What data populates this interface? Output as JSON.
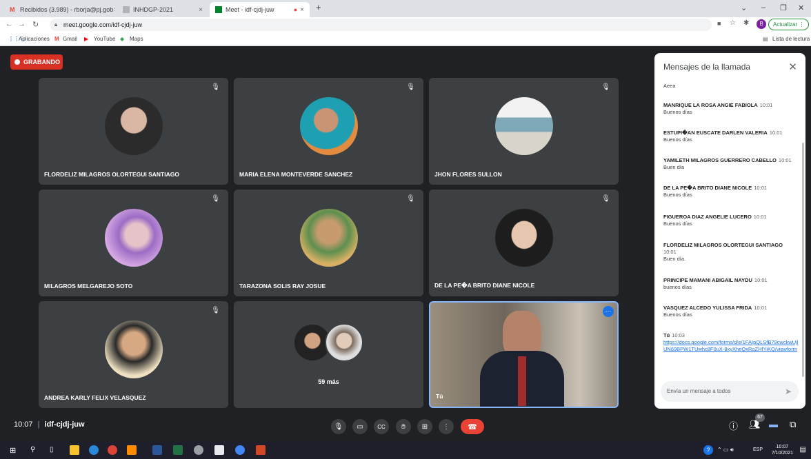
{
  "browser": {
    "tabs": [
      {
        "label": "Recibidos (3.989) - rborja@pj.gob",
        "close": "×"
      },
      {
        "label": "INHDGP-2021",
        "close": "×"
      },
      {
        "label": "Meet - idf-cjdj-juw",
        "close": "×"
      }
    ],
    "new_tab": "+",
    "url": "meet.google.com/idf-cjdj-juw",
    "update_label": "Actualizar",
    "profile_initial": "B",
    "bookmarks": [
      "Aplicaciones",
      "Gmail",
      "YouTube",
      "Maps"
    ],
    "reading_list": "Lista de lectura"
  },
  "meeting": {
    "recording_label": "GRABANDO",
    "time": "10:07",
    "code": "idf-cjdj-juw",
    "participants_count": "67",
    "more_label": "59 más",
    "self_label": "Tú"
  },
  "participants": [
    {
      "name": "FLORDELIZ MILAGROS OLORTEGUI SANTIAGO",
      "color": "#4a4a4a"
    },
    {
      "name": "MARIA ELENA MONTEVERDE SANCHEZ",
      "color": "#2aa7b5"
    },
    {
      "name": "JHON FLORES SULLON",
      "color": "#9fb8c4"
    },
    {
      "name": "MILAGROS MELGAREJO SOTO",
      "color": "#b98ad6"
    },
    {
      "name": "TARAZONA SOLIS RAY JOSUE",
      "color": "#c8a44b"
    },
    {
      "name": "DE LA PE�A BRITO DIANE NICOLE",
      "color": "#d9c4b8"
    },
    {
      "name": "ANDREA KARLY FELIX VELASQUEZ",
      "color": "#e5c9a0"
    }
  ],
  "chat": {
    "title": "Mensajes de la llamada",
    "first": "Aeea",
    "messages": [
      {
        "who": "MANRIQUE LA ROSA ANGIE FABIOLA",
        "time": "10:01",
        "text": "Buenos días"
      },
      {
        "who": "ESTUPI�AN EUSCATE DARLEN VALERIA",
        "time": "10:01",
        "text": "Buenos días"
      },
      {
        "who": "YAMILETH MILAGROS GUERRERO CABELLO",
        "time": "10:01",
        "text": "Buen día"
      },
      {
        "who": "DE LA PE�A BRITO DIANE NICOLE",
        "time": "10:01",
        "text": "Buenos días"
      },
      {
        "who": "FIGUEROA DIAZ ANGELIE LUCERO",
        "time": "10:01",
        "text": "Buenos días"
      },
      {
        "who": "FLORDELIZ MILAGROS OLORTEGUI SANTIAGO",
        "time": "10:01",
        "text": "Buen día."
      },
      {
        "who": "PRINCIPE MAMANI ABIGAIL NAYDU",
        "time": "10:01",
        "text": "buenos días"
      },
      {
        "who": "VASQUEZ ALCEDO YULISSA FRIDA",
        "time": "10:01",
        "text": "Buenos días"
      },
      {
        "who": "Tú",
        "time": "10:03",
        "text": "https://docs.google.com/forms/d/e/1FAIpQLSfB79cwckwUjlUN69BPW1TUwhc8F0uX-8xyXheQxRoZHfYiKQ/viewform"
      }
    ],
    "input_placeholder": "Envía un mensaje a todos"
  },
  "taskbar": {
    "lang": "ESP",
    "time": "10:07",
    "date": "7/10/2021"
  }
}
